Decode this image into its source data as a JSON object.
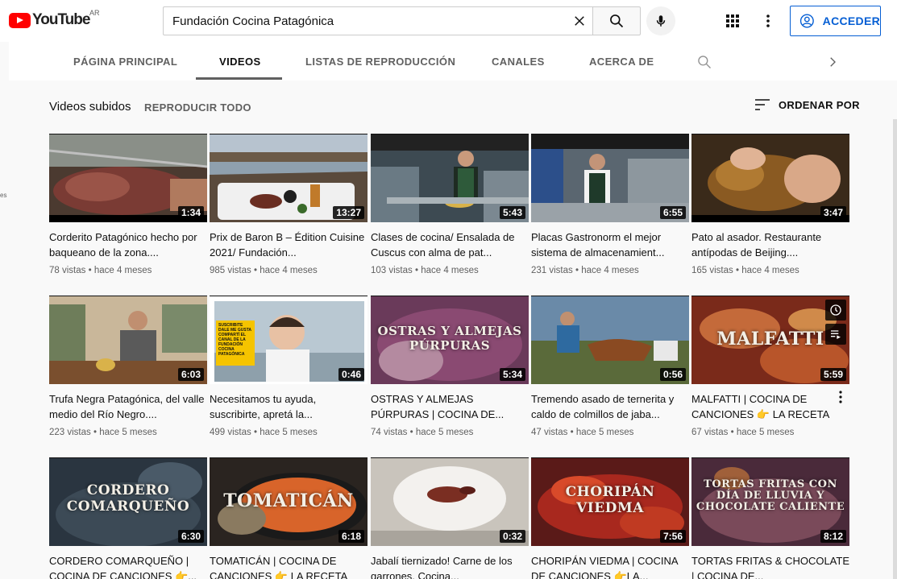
{
  "masthead": {
    "logo_text": "YouTube",
    "country": "AR",
    "search_value": "Fundación Cocina Patagónica",
    "signin_label": "ACCEDER"
  },
  "tabs": [
    {
      "label": "PÁGINA PRINCIPAL",
      "active": false
    },
    {
      "label": "VIDEOS",
      "active": true
    },
    {
      "label": "LISTAS DE REPRODUCCIÓN",
      "active": false
    },
    {
      "label": "CANALES",
      "active": false
    },
    {
      "label": "ACERCA DE",
      "active": false
    }
  ],
  "section": {
    "title": "Videos subidos",
    "play_all": "REPRODUCIR TODO",
    "sort_label": "ORDENAR POR"
  },
  "left_fragment": "es",
  "videos": [
    {
      "title": "Corderito Patagónico hecho por baqueano de la zona....",
      "views": "78 vistas",
      "age": "hace 4 meses",
      "duration": "1:34",
      "overlay": ""
    },
    {
      "title": "Prix de Baron B – Édition Cuisine 2021/ Fundación...",
      "views": "985 vistas",
      "age": "hace 4 meses",
      "duration": "13:27",
      "overlay": ""
    },
    {
      "title": "Clases de cocina/ Ensalada de Cuscus con alma de pat...",
      "views": "103 vistas",
      "age": "hace 4 meses",
      "duration": "5:43",
      "overlay": ""
    },
    {
      "title": "Placas Gastronorm el mejor sistema de almacenamient...",
      "views": "231 vistas",
      "age": "hace 4 meses",
      "duration": "6:55",
      "overlay": ""
    },
    {
      "title": "Pato al asador. Restaurante antípodas de Beijing....",
      "views": "165 vistas",
      "age": "hace 4 meses",
      "duration": "3:47",
      "overlay": ""
    },
    {
      "title": "Trufa Negra Patagónica, del valle medio del Río Negro....",
      "views": "223 vistas",
      "age": "hace 5 meses",
      "duration": "6:03",
      "overlay": ""
    },
    {
      "title": "Necesitamos tu ayuda, suscribirte, apretá la...",
      "views": "499 vistas",
      "age": "hace 5 meses",
      "duration": "0:46",
      "overlay": "SUSCRIBITE DALE ME GUSTA COMPARTÍ EL CANAL DE LA FUNDACIÓN COCINA PATAGÓNICA"
    },
    {
      "title": "OSTRAS Y ALMEJAS PÚRPURAS | COCINA DE...",
      "views": "74 vistas",
      "age": "hace 5 meses",
      "duration": "5:34",
      "overlay": "OSTRAS Y ALMEJAS PÚRPURAS"
    },
    {
      "title": "Tremendo asado de ternerita y caldo de colmillos de jaba...",
      "views": "47 vistas",
      "age": "hace 5 meses",
      "duration": "0:56",
      "overlay": ""
    },
    {
      "title": "MALFATTI | COCINA DE CANCIONES 👉 LA RECETA",
      "views": "67 vistas",
      "age": "hace 5 meses",
      "duration": "5:59",
      "overlay": "MALFATTI"
    },
    {
      "title": "CORDERO COMARQUEÑO | COCINA DE CANCIONES 👉...",
      "views": "",
      "age": "",
      "duration": "6:30",
      "overlay": "CORDERO COMARQUEÑO"
    },
    {
      "title": "TOMATICÁN | COCINA DE CANCIONES 👉 LA RECETA",
      "views": "",
      "age": "",
      "duration": "6:18",
      "overlay": "TOMATICÁN"
    },
    {
      "title": "Jabalí tiernizado! Carne de los garrones. Cocina...",
      "views": "",
      "age": "",
      "duration": "0:32",
      "overlay": ""
    },
    {
      "title": "CHORIPÁN VIEDMA | COCINA DE CANCIONES 👉LA...",
      "views": "",
      "age": "",
      "duration": "7:56",
      "overlay": "CHORIPÁN VIEDMA"
    },
    {
      "title": "TORTAS FRITAS & CHOCOLATE | COCINA DE...",
      "views": "",
      "age": "",
      "duration": "8:12",
      "overlay": "TORTAS FRITAS CON DÍA DE LLUVIA Y CHOCOLATE CALIENTE"
    }
  ],
  "colors": {
    "accent_blue": "#065fd4",
    "youtube_red": "#ff0000",
    "secondary_text": "#606060"
  }
}
